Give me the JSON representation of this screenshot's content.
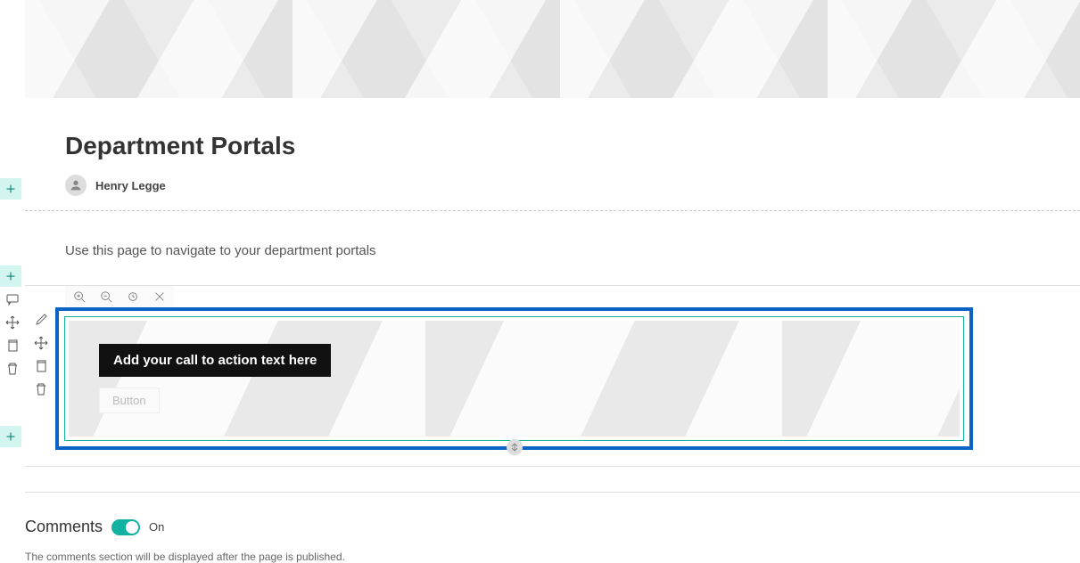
{
  "page": {
    "title": "Department Portals",
    "author": "Henry Legge",
    "description": "Use this page to navigate to your department portals"
  },
  "cta": {
    "text": "Add your call to action text here",
    "button_label": "Button"
  },
  "comments": {
    "label": "Comments",
    "state": "On",
    "note": "The comments section will be displayed after the page is published."
  },
  "icons": {
    "plus": "+",
    "edit": "edit-icon",
    "move": "move-icon",
    "copy": "copy-icon",
    "delete": "delete-icon",
    "zoom_in": "zoom-in-icon",
    "zoom_out": "zoom-out-icon",
    "reset": "reset-icon",
    "close": "close-icon",
    "comment": "comment-icon",
    "handle": "drag-handle-icon"
  }
}
